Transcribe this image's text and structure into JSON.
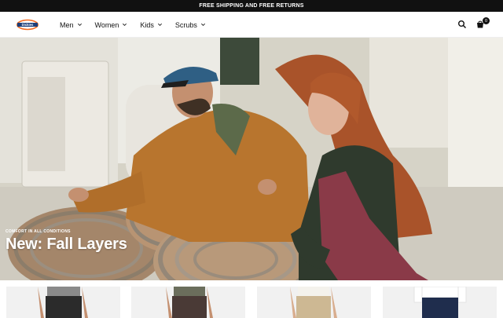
{
  "announcement": {
    "text": "FREE SHIPPING AND FREE RETURNS"
  },
  "brand": {
    "logo_name": "dickies-logo",
    "logo_text": "Dickies",
    "accent": "#f26b21"
  },
  "nav": {
    "items": [
      {
        "label": "Men"
      },
      {
        "label": "Women"
      },
      {
        "label": "Kids"
      },
      {
        "label": "Scrubs"
      }
    ]
  },
  "header_icons": {
    "search": "search-icon",
    "cart": "cart-icon",
    "cart_count": "0"
  },
  "hero": {
    "eyebrow": "COMFORT IN ALL CONDITIONS",
    "title": "New: Fall Layers"
  },
  "products": [
    {
      "name": "product-card-1",
      "shirt_color": "#8a8a8a",
      "pants_color": "#2b2b2b"
    },
    {
      "name": "product-card-2",
      "shirt_color": "#6b6e5c",
      "pants_color": "#4a3a36"
    },
    {
      "name": "product-card-3",
      "shirt_color": "#f4f2ec",
      "pants_color": "#cdb893"
    },
    {
      "name": "product-card-4",
      "shirt_color": "#ffffff",
      "pants_color": "#1f2d4d"
    }
  ]
}
